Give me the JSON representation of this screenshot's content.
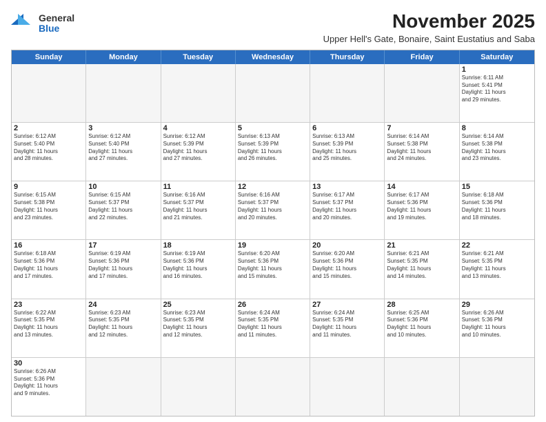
{
  "logo": {
    "general": "General",
    "blue": "Blue"
  },
  "title": "November 2025",
  "subtitle": "Upper Hell's Gate, Bonaire, Saint Eustatius and Saba",
  "header_days": [
    "Sunday",
    "Monday",
    "Tuesday",
    "Wednesday",
    "Thursday",
    "Friday",
    "Saturday"
  ],
  "weeks": [
    [
      {
        "day": "",
        "content": ""
      },
      {
        "day": "",
        "content": ""
      },
      {
        "day": "",
        "content": ""
      },
      {
        "day": "",
        "content": ""
      },
      {
        "day": "",
        "content": ""
      },
      {
        "day": "",
        "content": ""
      },
      {
        "day": "1",
        "content": "Sunrise: 6:11 AM\nSunset: 5:41 PM\nDaylight: 11 hours\nand 29 minutes."
      }
    ],
    [
      {
        "day": "2",
        "content": "Sunrise: 6:12 AM\nSunset: 5:40 PM\nDaylight: 11 hours\nand 28 minutes."
      },
      {
        "day": "3",
        "content": "Sunrise: 6:12 AM\nSunset: 5:40 PM\nDaylight: 11 hours\nand 27 minutes."
      },
      {
        "day": "4",
        "content": "Sunrise: 6:12 AM\nSunset: 5:39 PM\nDaylight: 11 hours\nand 27 minutes."
      },
      {
        "day": "5",
        "content": "Sunrise: 6:13 AM\nSunset: 5:39 PM\nDaylight: 11 hours\nand 26 minutes."
      },
      {
        "day": "6",
        "content": "Sunrise: 6:13 AM\nSunset: 5:39 PM\nDaylight: 11 hours\nand 25 minutes."
      },
      {
        "day": "7",
        "content": "Sunrise: 6:14 AM\nSunset: 5:38 PM\nDaylight: 11 hours\nand 24 minutes."
      },
      {
        "day": "8",
        "content": "Sunrise: 6:14 AM\nSunset: 5:38 PM\nDaylight: 11 hours\nand 23 minutes."
      }
    ],
    [
      {
        "day": "9",
        "content": "Sunrise: 6:15 AM\nSunset: 5:38 PM\nDaylight: 11 hours\nand 23 minutes."
      },
      {
        "day": "10",
        "content": "Sunrise: 6:15 AM\nSunset: 5:37 PM\nDaylight: 11 hours\nand 22 minutes."
      },
      {
        "day": "11",
        "content": "Sunrise: 6:16 AM\nSunset: 5:37 PM\nDaylight: 11 hours\nand 21 minutes."
      },
      {
        "day": "12",
        "content": "Sunrise: 6:16 AM\nSunset: 5:37 PM\nDaylight: 11 hours\nand 20 minutes."
      },
      {
        "day": "13",
        "content": "Sunrise: 6:17 AM\nSunset: 5:37 PM\nDaylight: 11 hours\nand 20 minutes."
      },
      {
        "day": "14",
        "content": "Sunrise: 6:17 AM\nSunset: 5:36 PM\nDaylight: 11 hours\nand 19 minutes."
      },
      {
        "day": "15",
        "content": "Sunrise: 6:18 AM\nSunset: 5:36 PM\nDaylight: 11 hours\nand 18 minutes."
      }
    ],
    [
      {
        "day": "16",
        "content": "Sunrise: 6:18 AM\nSunset: 5:36 PM\nDaylight: 11 hours\nand 17 minutes."
      },
      {
        "day": "17",
        "content": "Sunrise: 6:19 AM\nSunset: 5:36 PM\nDaylight: 11 hours\nand 17 minutes."
      },
      {
        "day": "18",
        "content": "Sunrise: 6:19 AM\nSunset: 5:36 PM\nDaylight: 11 hours\nand 16 minutes."
      },
      {
        "day": "19",
        "content": "Sunrise: 6:20 AM\nSunset: 5:36 PM\nDaylight: 11 hours\nand 15 minutes."
      },
      {
        "day": "20",
        "content": "Sunrise: 6:20 AM\nSunset: 5:36 PM\nDaylight: 11 hours\nand 15 minutes."
      },
      {
        "day": "21",
        "content": "Sunrise: 6:21 AM\nSunset: 5:35 PM\nDaylight: 11 hours\nand 14 minutes."
      },
      {
        "day": "22",
        "content": "Sunrise: 6:21 AM\nSunset: 5:35 PM\nDaylight: 11 hours\nand 13 minutes."
      }
    ],
    [
      {
        "day": "23",
        "content": "Sunrise: 6:22 AM\nSunset: 5:35 PM\nDaylight: 11 hours\nand 13 minutes."
      },
      {
        "day": "24",
        "content": "Sunrise: 6:23 AM\nSunset: 5:35 PM\nDaylight: 11 hours\nand 12 minutes."
      },
      {
        "day": "25",
        "content": "Sunrise: 6:23 AM\nSunset: 5:35 PM\nDaylight: 11 hours\nand 12 minutes."
      },
      {
        "day": "26",
        "content": "Sunrise: 6:24 AM\nSunset: 5:35 PM\nDaylight: 11 hours\nand 11 minutes."
      },
      {
        "day": "27",
        "content": "Sunrise: 6:24 AM\nSunset: 5:35 PM\nDaylight: 11 hours\nand 11 minutes."
      },
      {
        "day": "28",
        "content": "Sunrise: 6:25 AM\nSunset: 5:36 PM\nDaylight: 11 hours\nand 10 minutes."
      },
      {
        "day": "29",
        "content": "Sunrise: 6:26 AM\nSunset: 5:36 PM\nDaylight: 11 hours\nand 10 minutes."
      }
    ],
    [
      {
        "day": "30",
        "content": "Sunrise: 6:26 AM\nSunset: 5:36 PM\nDaylight: 11 hours\nand 9 minutes."
      },
      {
        "day": "",
        "content": ""
      },
      {
        "day": "",
        "content": ""
      },
      {
        "day": "",
        "content": ""
      },
      {
        "day": "",
        "content": ""
      },
      {
        "day": "",
        "content": ""
      },
      {
        "day": "",
        "content": ""
      }
    ]
  ]
}
